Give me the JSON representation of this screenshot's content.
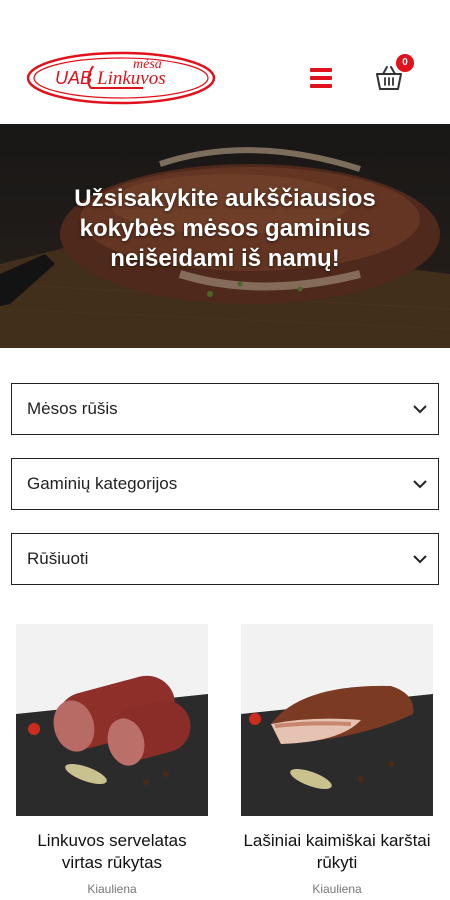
{
  "header": {
    "logo": {
      "prefix": "UAB",
      "name": "Linkuvos",
      "tagline": "mėsa"
    },
    "menu_icon": "hamburger-menu-icon",
    "cart_icon": "shopping-basket-icon",
    "cart_count": "0"
  },
  "hero": {
    "title": "Užsisakykite aukščiausios kokybės mėsos gaminius neišeidami iš namų!"
  },
  "filters": [
    {
      "label": "Mėsos rūšis"
    },
    {
      "label": "Gaminių kategorijos"
    },
    {
      "label": "Rūšiuoti"
    }
  ],
  "products": [
    {
      "name": "Linkuvos servelatas virtas rūkytas",
      "category": "Kiauliena"
    },
    {
      "name": "Lašiniai kaimiškai karštai rūkyti",
      "category": "Kiauliena"
    }
  ],
  "colors": {
    "accent": "#e0121b",
    "border": "#222222"
  }
}
